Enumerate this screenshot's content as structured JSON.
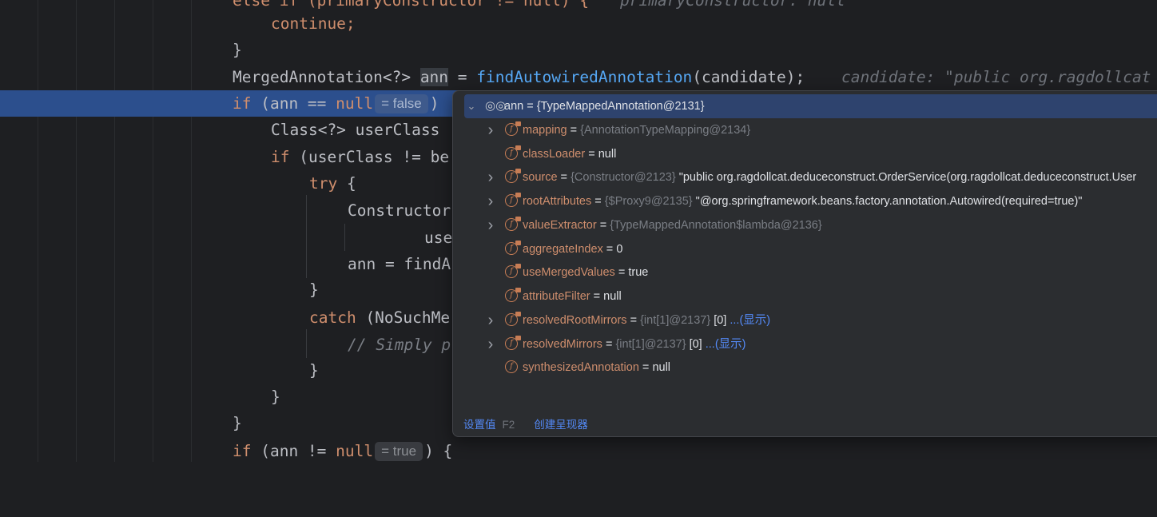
{
  "code": {
    "line0": {
      "prefix": "else if (primaryConstructor != null) {",
      "comment": "primaryConstructor: null"
    },
    "line1": "continue;",
    "line2": "}",
    "line3": {
      "type": "MergedAnnotation<?> ",
      "var": "ann",
      "assign": " = ",
      "method": "findAutowiredAnnotation",
      "args": "(candidate);",
      "comment": "candidate: \"public org.ragdollcat"
    },
    "line4": {
      "kw": "if",
      "text": " (ann == ",
      "null": "null",
      "inline": "= false",
      "rest": ")"
    },
    "line5": "Class<?> userClass",
    "line6": {
      "kw": "if",
      "text": " (userClass != be"
    },
    "line7": {
      "kw": "try",
      "text": " {"
    },
    "line8": "Constructor",
    "line9": "use",
    "line10": "ann = findA",
    "line11": "}",
    "line12": {
      "kw": "catch",
      "text": " (NoSuchMe"
    },
    "line13": "// Simply p",
    "line14": "}",
    "line15": "}",
    "line16": "}",
    "line17": {
      "kw": "if",
      "text": " (ann != ",
      "null": "null",
      "inline": "= true",
      "rest": ") {"
    }
  },
  "debug_popup": {
    "root": {
      "label": "ann = {TypeMappedAnnotation@2131}"
    },
    "fields": [
      {
        "name": "mapping",
        "eq": " = ",
        "ref": "{AnnotationTypeMapping@2134}",
        "value": "",
        "link": "",
        "expandable": true
      },
      {
        "name": "classLoader",
        "eq": " = ",
        "ref": "",
        "value": "null",
        "link": "",
        "expandable": false
      },
      {
        "name": "source",
        "eq": " = ",
        "ref": "{Constructor@2123} ",
        "value": "\"public org.ragdollcat.deduceconstruct.OrderService(org.ragdollcat.deduceconstruct.User",
        "link": "",
        "expandable": true
      },
      {
        "name": "rootAttributes",
        "eq": " = ",
        "ref": "{$Proxy9@2135} ",
        "value": "\"@org.springframework.beans.factory.annotation.Autowired(required=true)\"",
        "link": "",
        "expandable": true
      },
      {
        "name": "valueExtractor",
        "eq": " = ",
        "ref": "{TypeMappedAnnotation$lambda@2136}",
        "value": "",
        "link": "",
        "expandable": true
      },
      {
        "name": "aggregateIndex",
        "eq": " = ",
        "ref": "",
        "value": "0",
        "link": "",
        "expandable": false
      },
      {
        "name": "useMergedValues",
        "eq": " = ",
        "ref": "",
        "value": "true",
        "link": "",
        "expandable": false
      },
      {
        "name": "attributeFilter",
        "eq": " = ",
        "ref": "",
        "value": "null",
        "link": "",
        "expandable": false
      },
      {
        "name": "resolvedRootMirrors",
        "eq": " = ",
        "ref": "{int[1]@2137} ",
        "value": "[0] ",
        "link": "...(显示)",
        "expandable": true
      },
      {
        "name": "resolvedMirrors",
        "eq": " = ",
        "ref": "{int[1]@2137} ",
        "value": "[0] ",
        "link": "...(显示)",
        "expandable": true
      },
      {
        "name": "synthesizedAnnotation",
        "eq": " = ",
        "ref": "",
        "value": "null",
        "link": "",
        "expandable": false
      }
    ],
    "footer": {
      "set_value": "设置值",
      "set_value_hint": "F2",
      "create_renderer": "创建呈现器"
    }
  },
  "colors": {
    "keyword": "#cf8e6d",
    "method": "#56a8f5",
    "current_line": "#2c4f8d",
    "field_icon": "#c77d55",
    "link": "#548af7"
  }
}
